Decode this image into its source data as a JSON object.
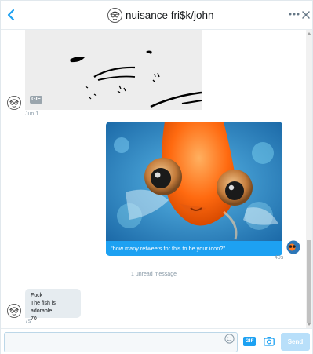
{
  "header": {
    "title": "nuisance fri$k/john",
    "back_icon": "chevron-left-icon",
    "more_icon": "more-horizontal-icon",
    "close_icon": "close-icon"
  },
  "thread": {
    "gif_message": {
      "badge": "GIF",
      "timestamp": "Jun 1"
    },
    "photo_message": {
      "caption": "\"how many retweets for this to be your icon?\"",
      "timestamp": "40s"
    },
    "divider": {
      "label": "1 unread message"
    },
    "received_message": {
      "lines": [
        "Fuck",
        "The fish is adorable",
        "70"
      ],
      "timestamp": "7s"
    }
  },
  "composer": {
    "input_value": "",
    "emoji_icon": "emoji-icon",
    "gif_label": "GIF",
    "camera_icon": "camera-icon",
    "send_label": "Send"
  },
  "colors": {
    "accent": "#1da1f2",
    "send_disabled": "#b8dffa",
    "bubble_received": "#e6ecf0",
    "timestamp": "#8899a6"
  }
}
